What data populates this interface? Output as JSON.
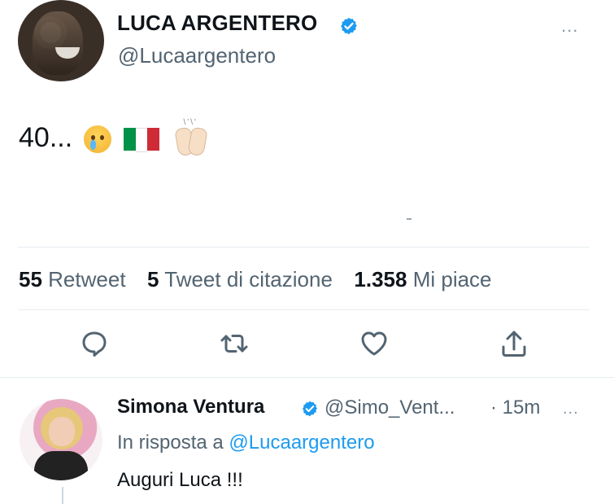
{
  "tweet": {
    "author": {
      "name": "LUCA ARGENTERO",
      "handle": "@Lucaargentero",
      "verified": true,
      "avatar_icon": "profile-photo"
    },
    "more_menu": "...",
    "text": "40...",
    "emojis": [
      "crying-face",
      "flag-italy",
      "raising-hands"
    ],
    "stats": {
      "retweets_count": "55",
      "retweets_label": "Retweet",
      "quotes_count": "5",
      "quotes_label": "Tweet di citazione",
      "likes_count": "1.358",
      "likes_label": "Mi piace"
    },
    "actions": [
      {
        "name": "reply",
        "icon": "reply-icon"
      },
      {
        "name": "retweet",
        "icon": "retweet-icon"
      },
      {
        "name": "like",
        "icon": "heart-icon"
      },
      {
        "name": "share",
        "icon": "share-icon"
      }
    ]
  },
  "reply": {
    "author_name": "Simona Ventura",
    "verified": true,
    "handle": "@Simo_Vent...",
    "time": "· 15m",
    "more_menu": "...",
    "context_prefix": "In risposta a",
    "context_mention": "@Lucaargentero",
    "text": "Auguri Luca !!!"
  },
  "colors": {
    "primary_text": "#0f1419",
    "secondary_text": "#536471",
    "accent": "#1d9bf0",
    "divider": "#e6ecf0",
    "flag_green": "#009246",
    "flag_white": "#ffffff",
    "flag_red": "#ce2b37"
  }
}
